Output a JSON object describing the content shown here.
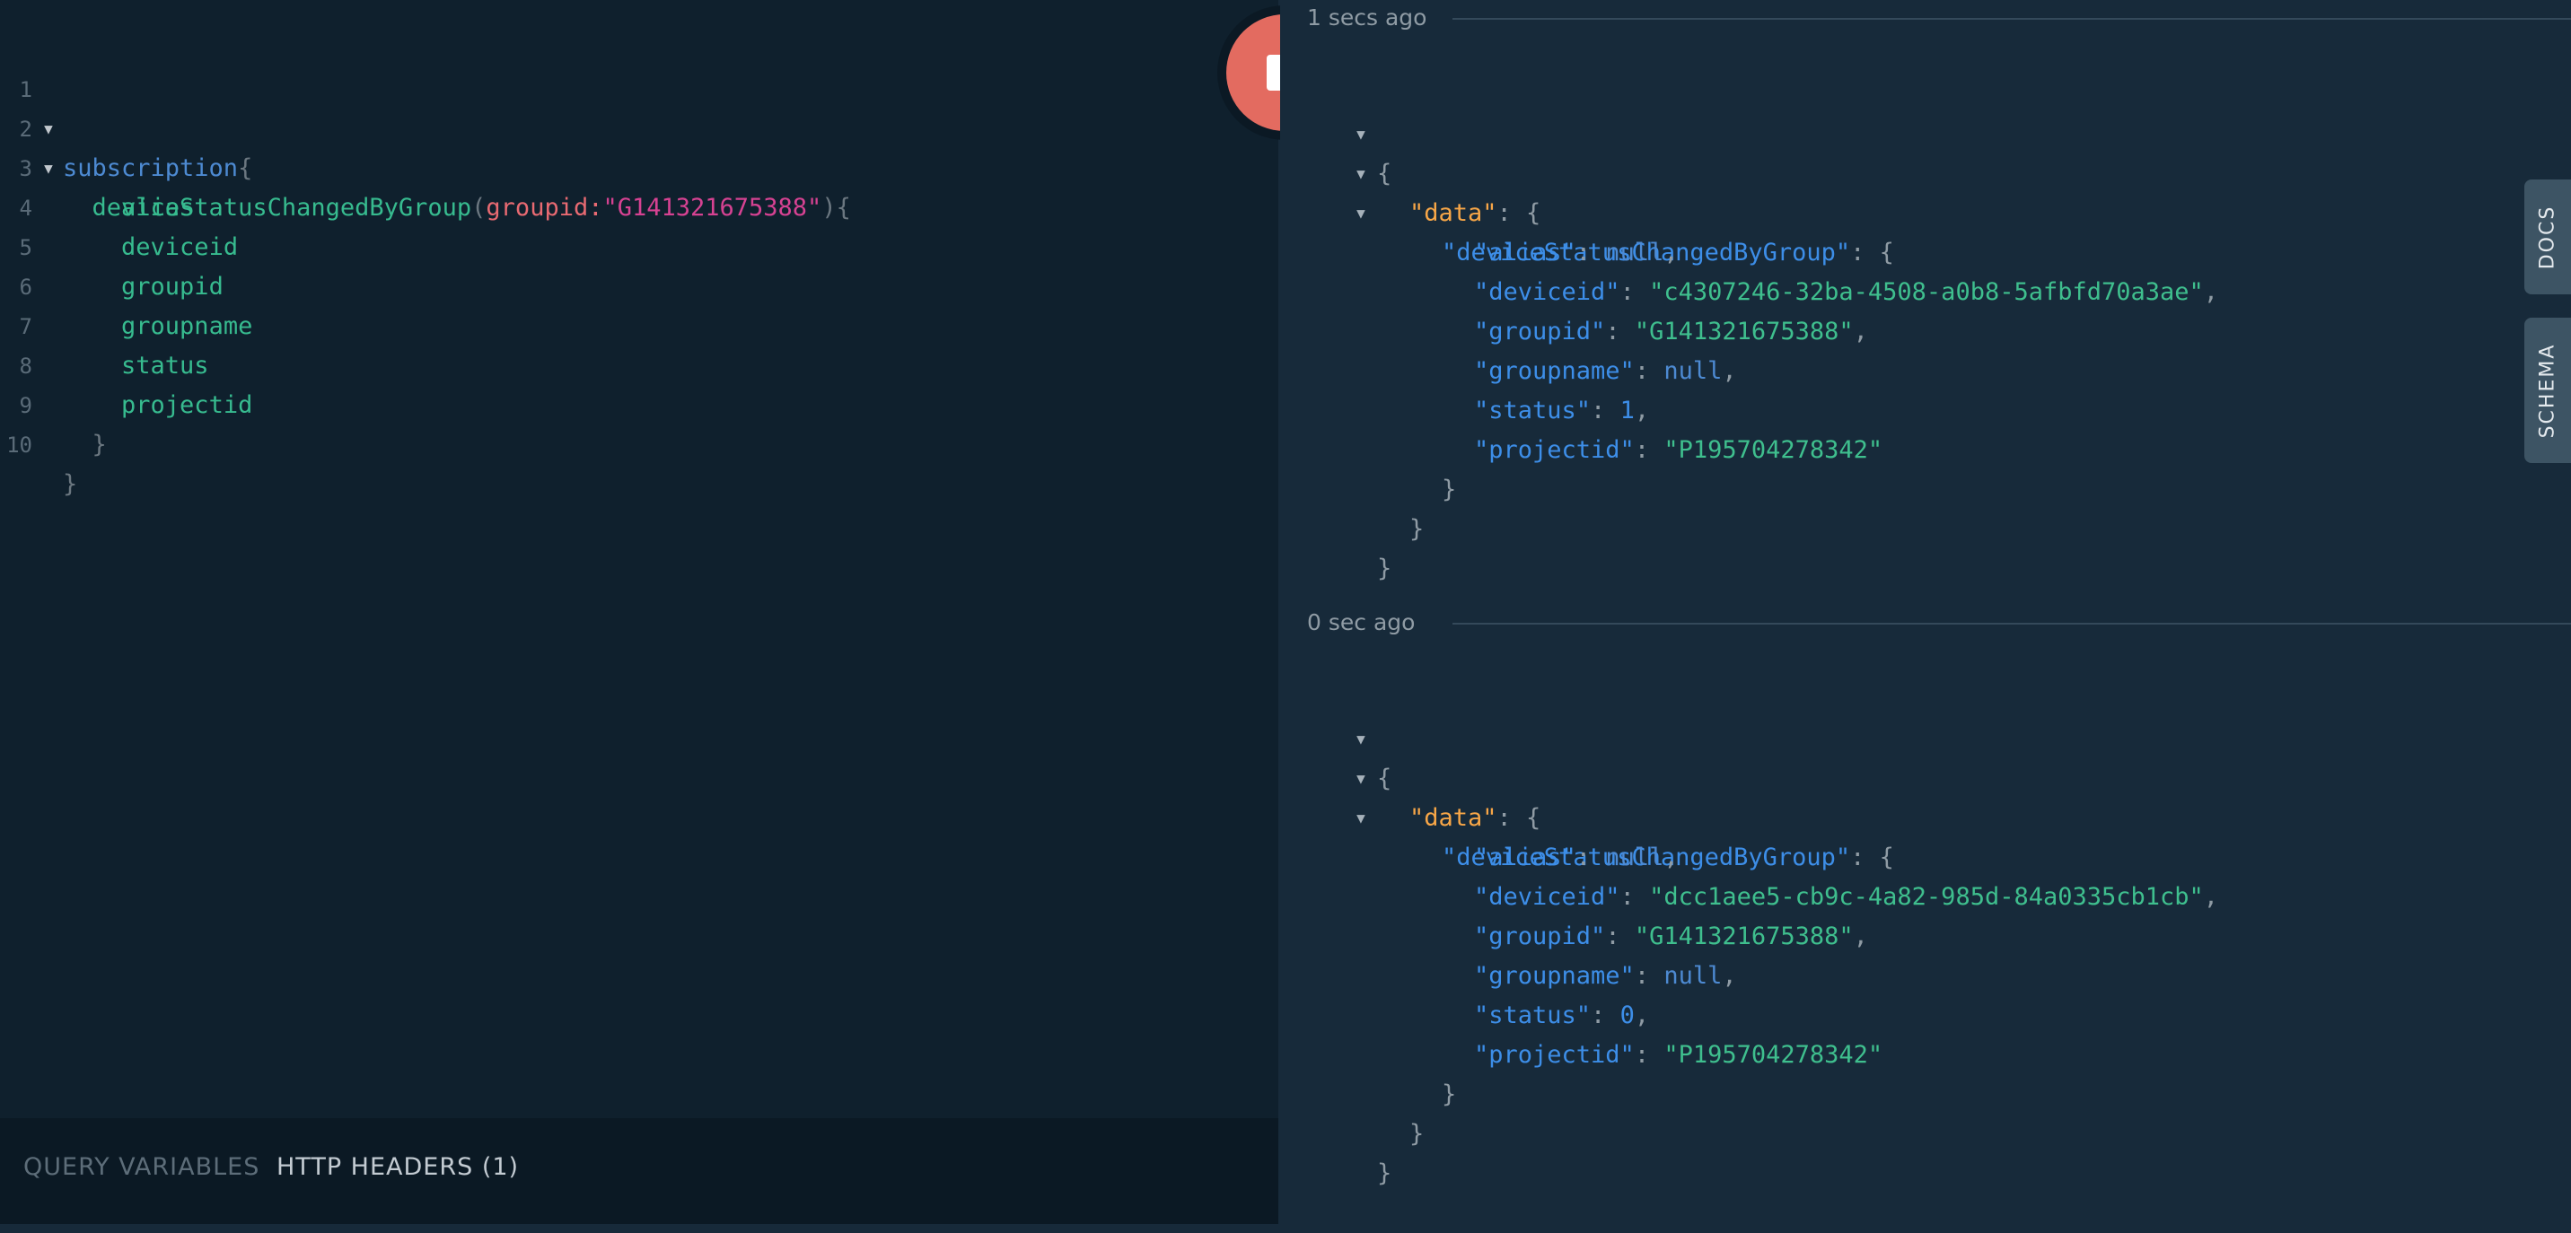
{
  "editor": {
    "line_numbers": [
      "1",
      "2",
      "3",
      "4",
      "5",
      "6",
      "7",
      "8",
      "9",
      "10"
    ],
    "keyword": "subscription",
    "open_brace": "{",
    "field": "deviceStatusChangedByGroup",
    "arg_name": "groupid",
    "arg_value": "\"G141321675388\"",
    "paren_open": "(",
    "paren_close": ")",
    "colon": ":",
    "selections": [
      "alias",
      "deviceid",
      "groupid",
      "groupname",
      "status",
      "projectid"
    ],
    "close_brace": "}"
  },
  "bottom_bar": {
    "query_variables_label": "QUERY VARIABLES",
    "http_headers_label": "HTTP HEADERS (1)"
  },
  "results": [
    {
      "timestamp": "1 secs ago",
      "alias": "null",
      "deviceid": "\"c4307246-32ba-4508-a0b8-5afbfd70a3ae\"",
      "groupid": "\"G141321675388\"",
      "groupname": "null",
      "status": "1",
      "projectid": "\"P195704278342\""
    },
    {
      "timestamp": "0 sec ago",
      "alias": "null",
      "deviceid": "\"dcc1aee5-cb9c-4a82-985d-84a0335cb1cb\"",
      "groupid": "\"G141321675388\"",
      "groupname": "null",
      "status": "0",
      "projectid": "\"P195704278342\""
    }
  ],
  "json_keys": {
    "data": "\"data\"",
    "root": "\"deviceStatusChangedByGroup\"",
    "alias": "\"alias\"",
    "deviceid": "\"deviceid\"",
    "groupid": "\"groupid\"",
    "groupname": "\"groupname\"",
    "status": "\"status\"",
    "projectid": "\"projectid\""
  },
  "side_tabs": {
    "docs": "DOCS",
    "schema": "SCHEMA"
  },
  "icons": {
    "run": "stop-icon",
    "fold": "fold-arrow-icon"
  },
  "colors": {
    "run_button": "#e36b60",
    "keyword": "#4d8ad2",
    "field": "#37bb8f",
    "string_arg": "#d64292",
    "json_data_key": "#f7a647"
  }
}
